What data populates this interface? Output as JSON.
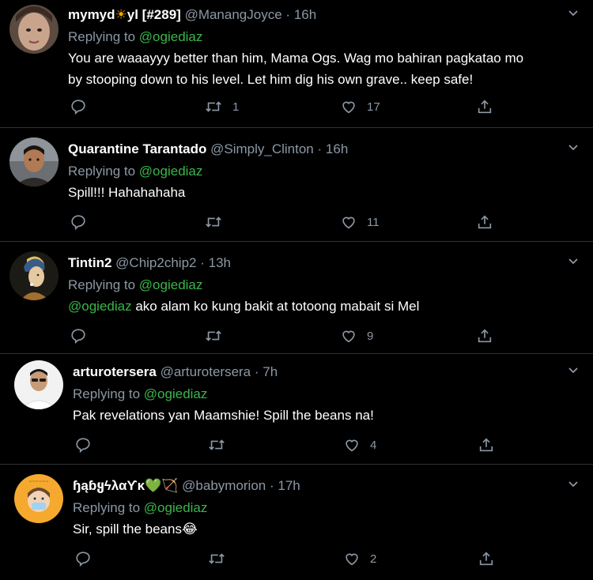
{
  "tweets": [
    {
      "name_prefix": "mymyd",
      "name_emoji": "☀",
      "name_suffix": "yl [#289]",
      "handle": "@ManangJoyce",
      "dot": "·",
      "time": "16h",
      "replying_label": "Replying to",
      "replying_to": "@ogiediaz",
      "text_line1": "You are waaayyy better than him, Mama Ogs. Wag mo bahiran pagkatao mo",
      "text_line2": "by stooping down to his level. Let him dig his own grave.. keep safe!",
      "retweets": "1",
      "likes": "17"
    },
    {
      "name": "Quarantine Tarantado",
      "handle": "@Simply_Clinton",
      "dot": "·",
      "time": "16h",
      "replying_label": "Replying to",
      "replying_to": "@ogiediaz",
      "text": "Spill!!! Hahahahaha",
      "retweets": "",
      "likes": "11"
    },
    {
      "name": "Tintin2",
      "handle": "@Chip2chip2",
      "dot": "·",
      "time": "13h",
      "replying_label": "Replying to",
      "replying_to": "@ogiediaz",
      "text_mention": "@ogiediaz",
      "text": " ako alam ko kung bakit at totoong mabait si Mel",
      "retweets": "",
      "likes": "9"
    },
    {
      "name": "arturotersera",
      "handle": "@arturotersera",
      "dot": "·",
      "time": "7h",
      "replying_label": "Replying to",
      "replying_to": "@ogiediaz",
      "text": "Pak revelations yan Maamshie! Spill the beans na!",
      "retweets": "",
      "likes": "4"
    },
    {
      "name": "ɧąɓყϟλαϒκ",
      "name_emoji": "💚🏹",
      "handle": "@babymorion",
      "dot": "·",
      "time": "17h",
      "replying_label": "Replying to",
      "replying_to": "@ogiediaz",
      "text": "Sir, spill the beans",
      "text_emoji": "😂",
      "retweets": "",
      "likes": "2"
    }
  ],
  "icons": {
    "reply": "reply-icon",
    "retweet": "retweet-icon",
    "like": "heart-icon",
    "share": "share-icon",
    "more": "chevron-down-icon"
  },
  "colors": {
    "background": "#000000",
    "text": "#ffffff",
    "muted": "#8b98a5",
    "mention": "#3ab54a",
    "divider": "#2f3336"
  }
}
